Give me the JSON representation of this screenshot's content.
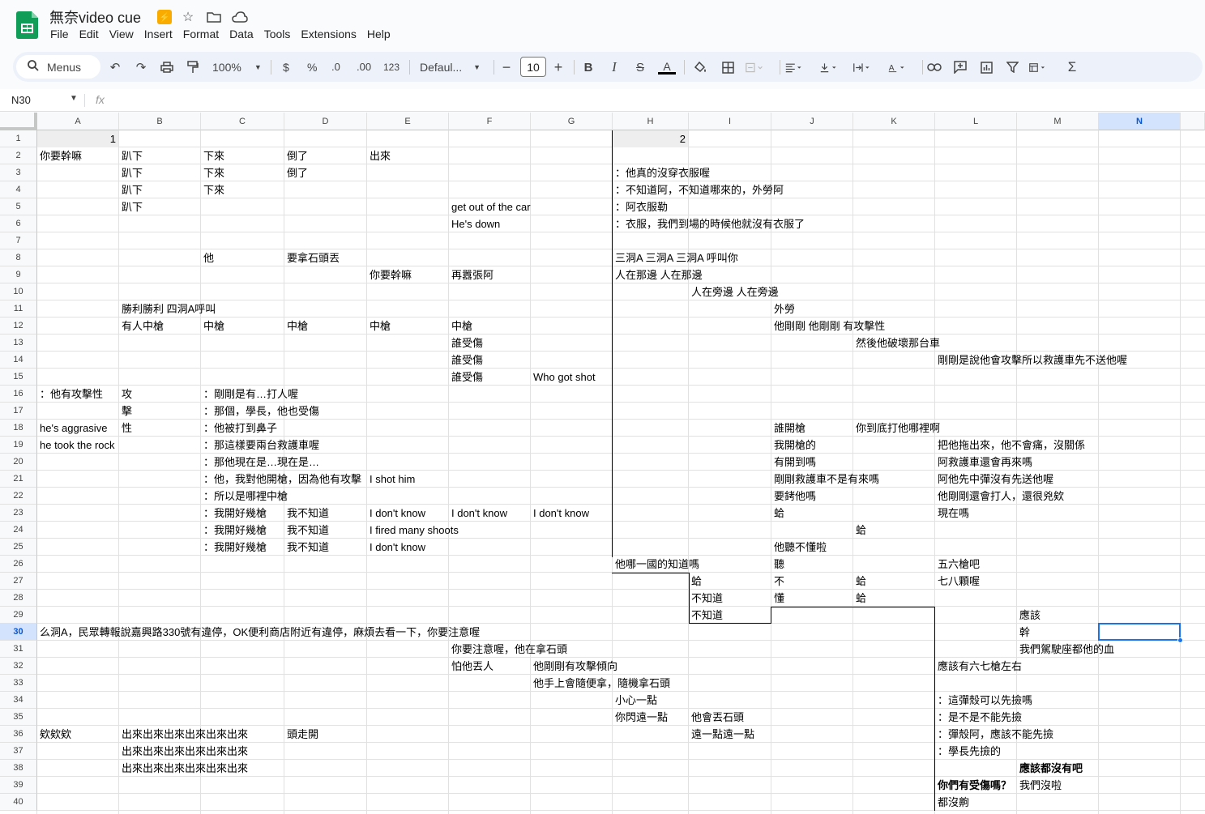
{
  "doc": {
    "title": "無奈video cue"
  },
  "menu": [
    "File",
    "Edit",
    "View",
    "Insert",
    "Format",
    "Data",
    "Tools",
    "Extensions",
    "Help"
  ],
  "toolbar": {
    "search_label": "Menus",
    "zoom": "100%",
    "currency": "$",
    "percent": "%",
    "dec_decrease": ".0",
    "dec_increase": ".00",
    "number_format": "123",
    "font": "Defaul...",
    "font_size": "10"
  },
  "namebox": "N30",
  "fx": "fx",
  "columns": [
    "A",
    "B",
    "C",
    "D",
    "E",
    "F",
    "G",
    "H",
    "I",
    "J",
    "K",
    "L",
    "M",
    "N"
  ],
  "selected_column": "N",
  "selected_row": 30,
  "rows": [
    1,
    2,
    3,
    4,
    5,
    6,
    7,
    8,
    9,
    10,
    11,
    12,
    13,
    14,
    15,
    16,
    17,
    18,
    19,
    20,
    21,
    22,
    23,
    24,
    25,
    26,
    27,
    28,
    29,
    30,
    31,
    32,
    33,
    34,
    35,
    36,
    37,
    38,
    39,
    40
  ],
  "cells": [
    {
      "r": 1,
      "c": "A",
      "v": "1",
      "num": true
    },
    {
      "r": 1,
      "c": "H",
      "v": "2",
      "num": true
    },
    {
      "r": 2,
      "c": "A",
      "v": "你要幹嘛"
    },
    {
      "r": 2,
      "c": "B",
      "v": "趴下"
    },
    {
      "r": 2,
      "c": "C",
      "v": "下來"
    },
    {
      "r": 2,
      "c": "D",
      "v": "倒了"
    },
    {
      "r": 2,
      "c": "E",
      "v": "出來"
    },
    {
      "r": 3,
      "c": "B",
      "v": "趴下"
    },
    {
      "r": 3,
      "c": "C",
      "v": "下來"
    },
    {
      "r": 3,
      "c": "D",
      "v": "倒了"
    },
    {
      "r": 3,
      "c": "H",
      "v": "：他真的沒穿衣服喔"
    },
    {
      "r": 4,
      "c": "B",
      "v": "趴下"
    },
    {
      "r": 4,
      "c": "C",
      "v": "下來"
    },
    {
      "r": 4,
      "c": "H",
      "v": "：不知道阿，不知道哪來的，外勞阿"
    },
    {
      "r": 5,
      "c": "B",
      "v": "趴下"
    },
    {
      "r": 5,
      "c": "F",
      "v": "get out of the car"
    },
    {
      "r": 5,
      "c": "H",
      "v": "：阿衣服勒"
    },
    {
      "r": 6,
      "c": "F",
      "v": "He's down"
    },
    {
      "r": 6,
      "c": "H",
      "v": "：衣服，我們到場的時候他就沒有衣服了"
    },
    {
      "r": 8,
      "c": "C",
      "v": "他"
    },
    {
      "r": 8,
      "c": "D",
      "v": "要拿石頭丟"
    },
    {
      "r": 8,
      "c": "H",
      "v": "三洞A 三洞A 三洞A 呼叫你"
    },
    {
      "r": 9,
      "c": "E",
      "v": "你要幹嘛"
    },
    {
      "r": 9,
      "c": "F",
      "v": "再囂張阿"
    },
    {
      "r": 9,
      "c": "H",
      "v": "人在那邊 人在那邊"
    },
    {
      "r": 10,
      "c": "I",
      "v": "人在旁邊 人在旁邊"
    },
    {
      "r": 11,
      "c": "B",
      "v": "勝利勝利 四洞A呼叫"
    },
    {
      "r": 11,
      "c": "J",
      "v": "外勞"
    },
    {
      "r": 12,
      "c": "B",
      "v": "有人中槍"
    },
    {
      "r": 12,
      "c": "C",
      "v": "中槍"
    },
    {
      "r": 12,
      "c": "D",
      "v": "中槍"
    },
    {
      "r": 12,
      "c": "E",
      "v": "中槍"
    },
    {
      "r": 12,
      "c": "F",
      "v": "中槍"
    },
    {
      "r": 12,
      "c": "J",
      "v": "他剛剛 他剛剛 有攻擊性"
    },
    {
      "r": 13,
      "c": "F",
      "v": "誰受傷"
    },
    {
      "r": 13,
      "c": "K",
      "v": "然後他破壞那台車"
    },
    {
      "r": 14,
      "c": "F",
      "v": "誰受傷"
    },
    {
      "r": 14,
      "c": "L",
      "v": "剛剛是說他會攻擊所以救護車先不送他喔"
    },
    {
      "r": 15,
      "c": "F",
      "v": "誰受傷"
    },
    {
      "r": 15,
      "c": "G",
      "v": "Who got shot"
    },
    {
      "r": 16,
      "c": "A",
      "v": "：他有攻擊性"
    },
    {
      "r": 16,
      "c": "B",
      "v": "攻"
    },
    {
      "r": 16,
      "c": "C",
      "v": "：剛剛是有…打人喔"
    },
    {
      "r": 17,
      "c": "B",
      "v": "擊"
    },
    {
      "r": 17,
      "c": "C",
      "v": "：那個，學長，他也受傷"
    },
    {
      "r": 18,
      "c": "A",
      "v": "he's aggrasive"
    },
    {
      "r": 18,
      "c": "B",
      "v": "性"
    },
    {
      "r": 18,
      "c": "C",
      "v": "：他被打到鼻子"
    },
    {
      "r": 18,
      "c": "J",
      "v": "誰開槍"
    },
    {
      "r": 18,
      "c": "K",
      "v": "你到底打他哪裡啊"
    },
    {
      "r": 19,
      "c": "A",
      "v": "he took the rock"
    },
    {
      "r": 19,
      "c": "C",
      "v": "：那這樣要兩台救護車喔"
    },
    {
      "r": 19,
      "c": "J",
      "v": "我開槍的"
    },
    {
      "r": 19,
      "c": "L",
      "v": "把他拖出來，他不會痛，沒關係"
    },
    {
      "r": 20,
      "c": "C",
      "v": "：那他現在是…現在是…"
    },
    {
      "r": 20,
      "c": "J",
      "v": "有開到嗎"
    },
    {
      "r": 20,
      "c": "L",
      "v": "阿救護車還會再來嗎"
    },
    {
      "r": 21,
      "c": "C",
      "v": "：他，我對他開槍，因為他有攻擊"
    },
    {
      "r": 21,
      "c": "E",
      "v": "I shot him"
    },
    {
      "r": 21,
      "c": "J",
      "v": "剛剛救護車不是有來嗎"
    },
    {
      "r": 21,
      "c": "L",
      "v": "阿他先中彈沒有先送他喔"
    },
    {
      "r": 22,
      "c": "C",
      "v": "：所以是哪裡中槍"
    },
    {
      "r": 22,
      "c": "J",
      "v": "要銬他嗎"
    },
    {
      "r": 22,
      "c": "L",
      "v": "他剛剛還會打人，還很兇欸"
    },
    {
      "r": 23,
      "c": "C",
      "v": "：我開好幾槍"
    },
    {
      "r": 23,
      "c": "D",
      "v": "我不知道"
    },
    {
      "r": 23,
      "c": "E",
      "v": "I don't know"
    },
    {
      "r": 23,
      "c": "F",
      "v": "I don't know"
    },
    {
      "r": 23,
      "c": "G",
      "v": "I don't know"
    },
    {
      "r": 23,
      "c": "J",
      "v": "蛤"
    },
    {
      "r": 23,
      "c": "L",
      "v": "現在嗎"
    },
    {
      "r": 24,
      "c": "C",
      "v": "：我開好幾槍"
    },
    {
      "r": 24,
      "c": "D",
      "v": "我不知道"
    },
    {
      "r": 24,
      "c": "E",
      "v": "I fired many shoots"
    },
    {
      "r": 24,
      "c": "K",
      "v": "蛤"
    },
    {
      "r": 25,
      "c": "C",
      "v": "：我開好幾槍"
    },
    {
      "r": 25,
      "c": "D",
      "v": "我不知道"
    },
    {
      "r": 25,
      "c": "E",
      "v": "I don't know"
    },
    {
      "r": 25,
      "c": "J",
      "v": "他聽不懂啦"
    },
    {
      "r": 26,
      "c": "H",
      "v": "他哪一國的知道嗎"
    },
    {
      "r": 26,
      "c": "J",
      "v": "聽"
    },
    {
      "r": 26,
      "c": "L",
      "v": "五六槍吧"
    },
    {
      "r": 27,
      "c": "I",
      "v": "蛤"
    },
    {
      "r": 27,
      "c": "J",
      "v": "不"
    },
    {
      "r": 27,
      "c": "K",
      "v": "蛤"
    },
    {
      "r": 27,
      "c": "L",
      "v": "七八顆喔"
    },
    {
      "r": 28,
      "c": "I",
      "v": "不知道"
    },
    {
      "r": 28,
      "c": "J",
      "v": "懂"
    },
    {
      "r": 28,
      "c": "K",
      "v": "蛤"
    },
    {
      "r": 29,
      "c": "I",
      "v": "不知道"
    },
    {
      "r": 29,
      "c": "M",
      "v": "應該"
    },
    {
      "r": 30,
      "c": "A",
      "v": "么洞A，民眾轉報說嘉興路330號有違停，OK便利商店附近有違停，麻煩去看一下，你要注意喔"
    },
    {
      "r": 30,
      "c": "M",
      "v": "幹"
    },
    {
      "r": 31,
      "c": "F",
      "v": "你要注意喔，他在拿石頭"
    },
    {
      "r": 31,
      "c": "M",
      "v": "我們駕駛座都他的血"
    },
    {
      "r": 32,
      "c": "F",
      "v": "怕他丟人"
    },
    {
      "r": 32,
      "c": "G",
      "v": "他剛剛有攻擊傾向"
    },
    {
      "r": 32,
      "c": "L",
      "v": "應該有六七槍左右"
    },
    {
      "r": 33,
      "c": "G",
      "v": "他手上會隨便拿，隨機拿石頭"
    },
    {
      "r": 34,
      "c": "H",
      "v": "小心一點"
    },
    {
      "r": 34,
      "c": "L",
      "v": "：這彈殼可以先撿嗎"
    },
    {
      "r": 35,
      "c": "H",
      "v": "你閃遠一點"
    },
    {
      "r": 35,
      "c": "I",
      "v": "他會丟石頭"
    },
    {
      "r": 35,
      "c": "L",
      "v": "：是不是不能先撿"
    },
    {
      "r": 36,
      "c": "A",
      "v": "欸欸欸"
    },
    {
      "r": 36,
      "c": "B",
      "v": "出來出來出來出來出來出來"
    },
    {
      "r": 36,
      "c": "D",
      "v": "頭走開"
    },
    {
      "r": 36,
      "c": "I",
      "v": "遠一點遠一點"
    },
    {
      "r": 36,
      "c": "L",
      "v": "：彈殼阿，應該不能先撿"
    },
    {
      "r": 37,
      "c": "B",
      "v": "出來出來出來出來出來出來"
    },
    {
      "r": 37,
      "c": "L",
      "v": "：學長先撿的"
    },
    {
      "r": 38,
      "c": "B",
      "v": "出來出來出來出來出來出來"
    },
    {
      "r": 38,
      "c": "M",
      "v": "應該都沒有吧",
      "bold": true
    },
    {
      "r": 39,
      "c": "L",
      "v": "你們有受傷嗎？",
      "bold": true
    },
    {
      "r": 39,
      "c": "M",
      "v": "我們沒啦"
    },
    {
      "r": 40,
      "c": "L",
      "v": "都沒齁"
    }
  ]
}
